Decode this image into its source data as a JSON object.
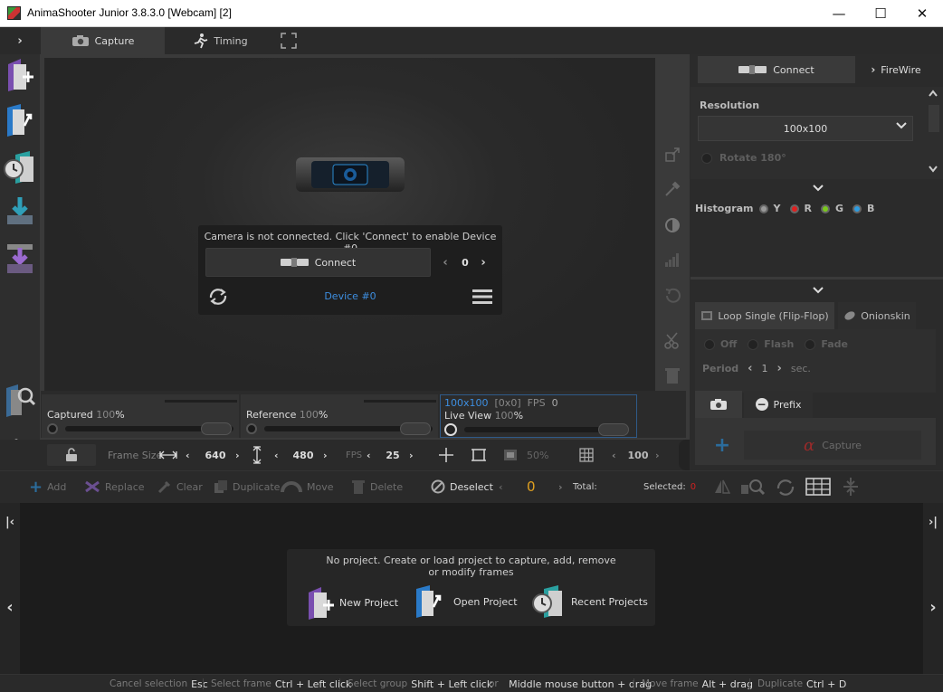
{
  "window": {
    "title": "AnimaShooter Junior 3.8.3.0 [Webcam] [2]",
    "minimize": "—",
    "maximize": "☐",
    "close": "✕"
  },
  "tabs": [
    {
      "label": "Capture",
      "icon": "camera-icon",
      "active": true
    },
    {
      "label": "Timing",
      "icon": "running-man-icon",
      "active": false
    }
  ],
  "camera_panel": {
    "message": "Camera is not connected. Click 'Connect' to enable Device #0",
    "connect_label": "Connect",
    "device_index": "0",
    "device_label": "Device #0"
  },
  "sliders": {
    "captured_label": "Captured",
    "captured_value": "100",
    "reference_label": "Reference",
    "reference_value": "100",
    "live_resolution": "100x100",
    "live_coords": "[0x0]",
    "fps_label": "FPS",
    "fps_value": "0",
    "live_label": "Live View",
    "live_value": "100",
    "percent": "%"
  },
  "framebar": {
    "frame_size_label": "Frame Size",
    "width": "640",
    "height": "480",
    "fps_label": "FPS",
    "fps": "25",
    "zoom": "50%",
    "grid_value": "100"
  },
  "right_panel": {
    "connect_label": "Connect",
    "firewire_label": "FireWire",
    "resolution_label": "Resolution",
    "resolution_value": "100x100",
    "rotate_label": "Rotate 180°",
    "histogram_label": "Histogram",
    "channels": [
      {
        "label": "Y",
        "color": "#9a9a9a"
      },
      {
        "label": "R",
        "color": "#e02020"
      },
      {
        "label": "G",
        "color": "#7ac81e"
      },
      {
        "label": "B",
        "color": "#2e9ce0"
      }
    ],
    "loop_label": "Loop Single (Flip-Flop)",
    "onionskin_label": "Onionskin",
    "off_label": "Off",
    "flash_label": "Flash",
    "fade_label": "Fade",
    "period_label": "Period",
    "period_value": "1",
    "period_unit": "sec.",
    "prefix_label": "Prefix",
    "capture_label": "Capture"
  },
  "frame_toolbar": {
    "add": "Add",
    "replace": "Replace",
    "clear": "Clear",
    "duplicate": "Duplicate",
    "move": "Move",
    "delete": "Delete",
    "deselect": "Deselect",
    "frame_counter": "0",
    "total_label": "Total:",
    "selected_label": "Selected:",
    "selected_value": "0"
  },
  "timeline": {
    "message": "No project. Create or load project to capture, add, remove or modify frames",
    "new_project": "New Project",
    "open_project": "Open Project",
    "recent_projects": "Recent Projects"
  },
  "statusbar": [
    {
      "k": "Cancel selection",
      "v": "Esc"
    },
    {
      "k": "Select frame",
      "v": "Ctrl + Left click"
    },
    {
      "k": "Select group",
      "v": "Shift + Left click"
    },
    {
      "k": "or",
      "v": "Middle mouse button + drag"
    },
    {
      "k": "Move frame",
      "v": "Alt + drag"
    },
    {
      "k": "Duplicate",
      "v": "Ctrl + D"
    }
  ],
  "colors": {
    "accent_blue": "#3d8ee0",
    "frame_counter": "#e0a020",
    "selected_red": "#d02020",
    "capture_red": "#c03030"
  }
}
